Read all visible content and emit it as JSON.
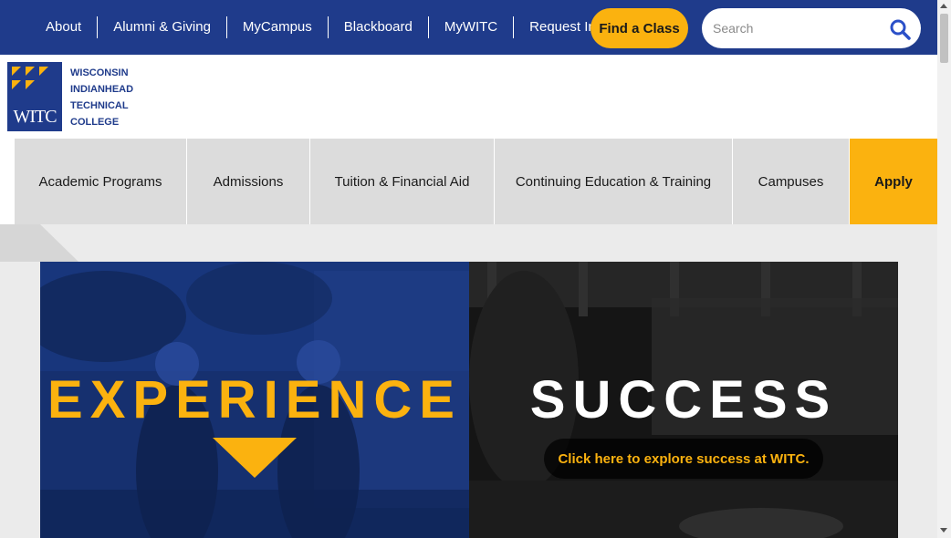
{
  "utility_nav": {
    "links": [
      "About",
      "Alumni & Giving",
      "MyCampus",
      "Blackboard",
      "MyWITC",
      "Request Info"
    ],
    "find_class_label": "Find a Class",
    "search_placeholder": "Search",
    "search_icon": "search-icon"
  },
  "logo": {
    "wordmark": "WITC",
    "lines": [
      "WISCONSIN",
      "INDIANHEAD",
      "TECHNICAL",
      "COLLEGE"
    ]
  },
  "main_nav": {
    "items": [
      "Academic Programs",
      "Admissions",
      "Tuition & Financial Aid",
      "Continuing Education & Training",
      "Campuses"
    ],
    "apply_label": "Apply"
  },
  "hero": {
    "left_title": "EXPERIENCE",
    "right_title": "SUCCESS",
    "right_cta": "Click here to explore success at WITC."
  },
  "colors": {
    "brand_blue": "#1f3b8b",
    "accent_gold": "#fbb20f",
    "nav_gray": "#dcdcdc"
  }
}
